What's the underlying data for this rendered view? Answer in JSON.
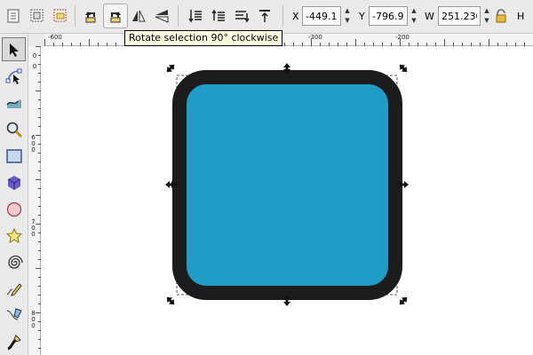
{
  "toolbar": {
    "x_label": "X",
    "x_value": "-449.134",
    "y_label": "Y",
    "y_value": "-796.992",
    "w_label": "W",
    "w_value": "251.230",
    "h_label": "H"
  },
  "tooltip": {
    "text": "Rotate selection 90° clockwise"
  },
  "ruler": {
    "top_labels": [
      "-600",
      "-300",
      "-200"
    ],
    "left_labels": [
      "0",
      "0",
      "600",
      "700",
      "800"
    ]
  },
  "colors": {
    "shape_fill": "#1f9dc6",
    "shape_stroke": "#1c1c1c",
    "toolbar_bg": "#eaeaea",
    "tooltip_bg": "#ffffe1"
  },
  "icons": {
    "toolbar": [
      "select-all-icon",
      "select-all-layers-icon",
      "deselect-icon",
      "rotate-ccw-icon",
      "rotate-cw-icon",
      "flip-horizontal-icon",
      "flip-vertical-icon",
      "raise-to-top-icon",
      "raise-icon",
      "lower-icon",
      "lower-to-bottom-icon",
      "lock-icon"
    ],
    "tools": [
      "selector-tool-icon",
      "node-tool-icon",
      "tweak-tool-icon",
      "zoom-tool-icon",
      "rectangle-tool-icon",
      "box3d-tool-icon",
      "ellipse-tool-icon",
      "star-tool-icon",
      "spiral-tool-icon",
      "pencil-tool-icon",
      "pen-tool-icon",
      "calligraphy-tool-icon"
    ]
  }
}
